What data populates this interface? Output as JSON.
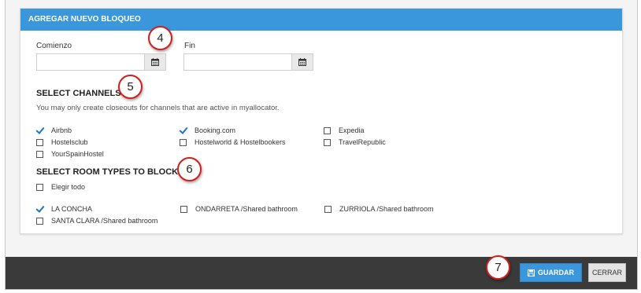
{
  "panel": {
    "title": "AGREGAR NUEVO BLOQUEO",
    "start_label": "Comienzo",
    "end_label": "Fin"
  },
  "channels": {
    "title": "SELECT CHANNELS",
    "description": "You may only create closeouts for channels that are active in myallocator.",
    "items": [
      {
        "label": "Airbnb",
        "checked": true
      },
      {
        "label": "Booking.com",
        "checked": true
      },
      {
        "label": "Expedia",
        "checked": false
      },
      {
        "label": "Hostelsclub",
        "checked": false
      },
      {
        "label": "Hostelworld & Hostelbookers",
        "checked": false
      },
      {
        "label": "TravelRepublic",
        "checked": false
      },
      {
        "label": "YourSpainHostel",
        "checked": false
      }
    ]
  },
  "room_types": {
    "title": "SELECT ROOM TYPES TO BLOCK",
    "select_all_label": "Elegir todo",
    "items": [
      {
        "label": "LA CONCHA",
        "checked": true
      },
      {
        "label": "ONDARRETA /Shared bathroom",
        "checked": false
      },
      {
        "label": "ZURRIOLA /Shared bathroom",
        "checked": false
      },
      {
        "label": "SANTA CLARA /Shared bathroom",
        "checked": false
      }
    ]
  },
  "footer": {
    "save_label": "GUARDAR",
    "close_label": "CERRAR"
  },
  "callouts": [
    "4",
    "5",
    "6",
    "7"
  ],
  "colors": {
    "accent": "#3a97dc",
    "footer_bg": "#3a3a3a",
    "callout_border": "#d31e1e",
    "check": "#1a73c9"
  },
  "icons": {
    "calendar": "calendar-icon",
    "save": "floppy-disk-icon",
    "check": "checkmark-icon"
  }
}
